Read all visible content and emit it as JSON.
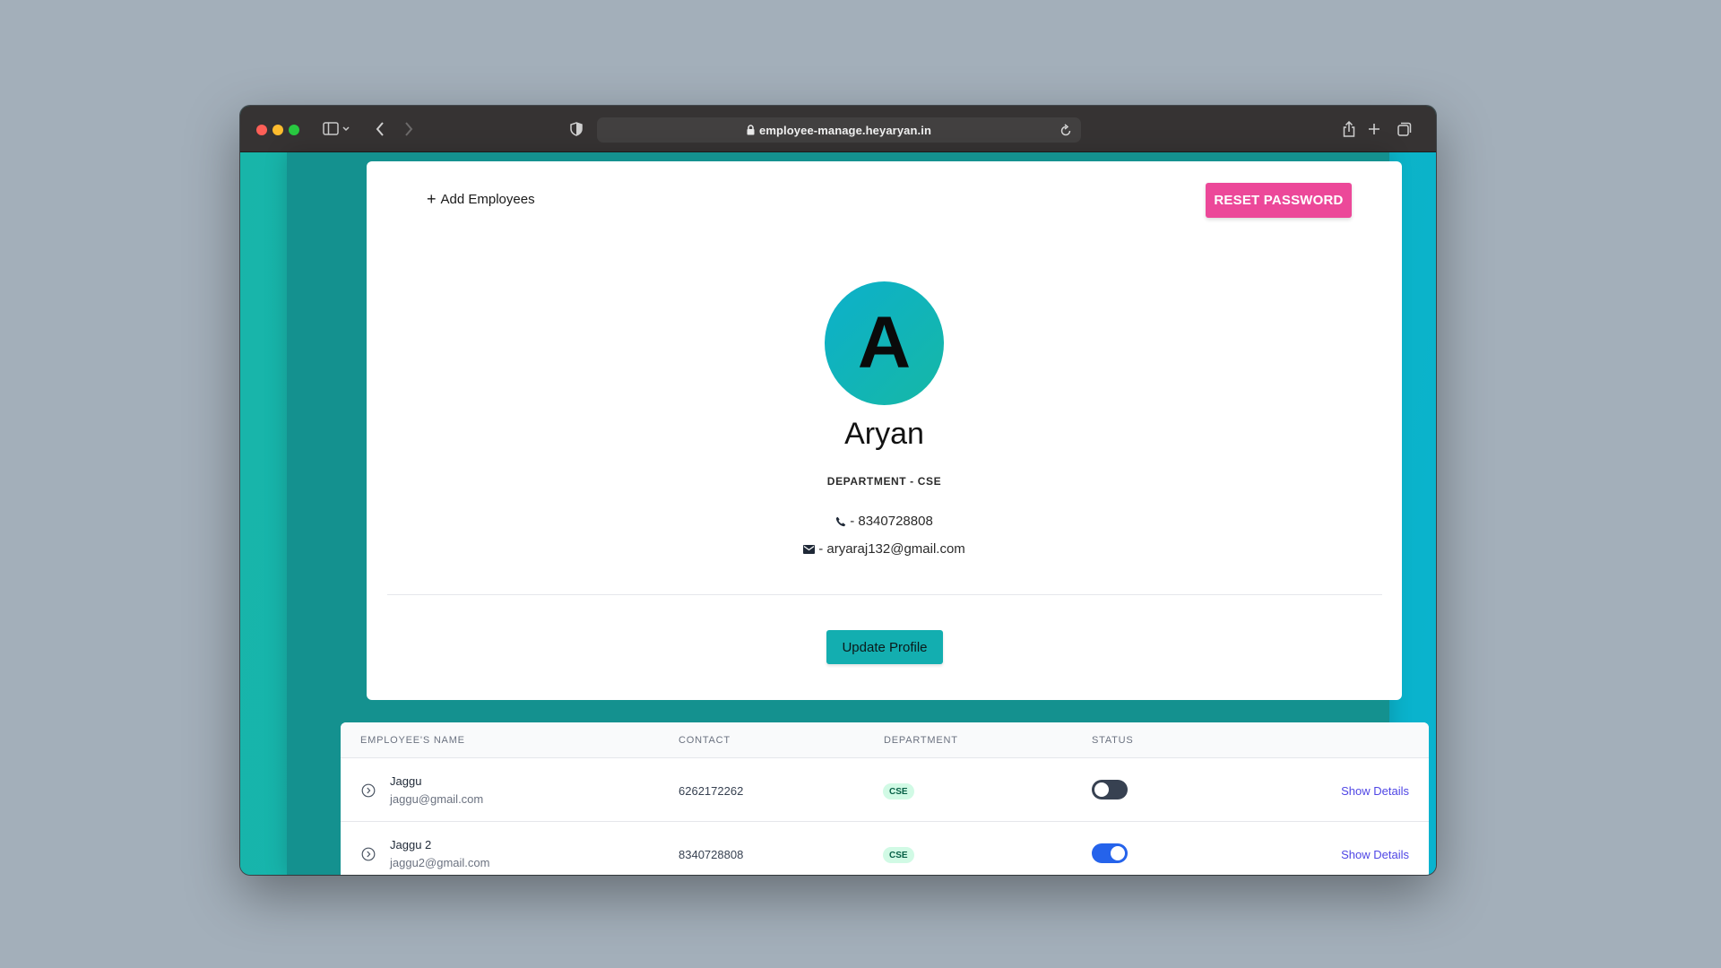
{
  "browser": {
    "url": "employee-manage.heyaryan.in",
    "icons": {
      "sidebar": "sidebar-toggle-icon",
      "back": "chevron-left-icon",
      "forward": "chevron-right-icon",
      "shield": "privacy-shield-icon",
      "lock": "lock-icon",
      "reload": "reload-icon",
      "share": "share-icon",
      "new_tab": "plus-icon",
      "tabs": "tab-overview-icon"
    }
  },
  "profile": {
    "add_employees_label": "Add Employees",
    "reset_password_label": "RESET PASSWORD",
    "avatar_initial": "A",
    "name": "Aryan",
    "department": "DEPARTMENT - CSE",
    "phone": "- 8340728808",
    "email": "- aryaraj132@gmail.com",
    "update_label": "Update Profile"
  },
  "table": {
    "headers": [
      "EMPLOYEE'S NAME",
      "CONTACT",
      "DEPARTMENT",
      "STATUS"
    ],
    "rows": [
      {
        "name": "Jaggu",
        "email": "jaggu@gmail.com",
        "contact": "6262172262",
        "department": "CSE",
        "status_on": false,
        "action": "Show Details"
      },
      {
        "name": "Jaggu 2",
        "email": "jaggu2@gmail.com",
        "contact": "8340728808",
        "department": "CSE",
        "status_on": true,
        "action": "Show Details"
      }
    ]
  },
  "colors": {
    "accent_pink": "#ec4899",
    "teal": "#13aeb0",
    "toggle_on": "#2563eb",
    "toggle_off": "#374151",
    "badge_bg": "#d1fae5",
    "link": "#4f46e5"
  }
}
